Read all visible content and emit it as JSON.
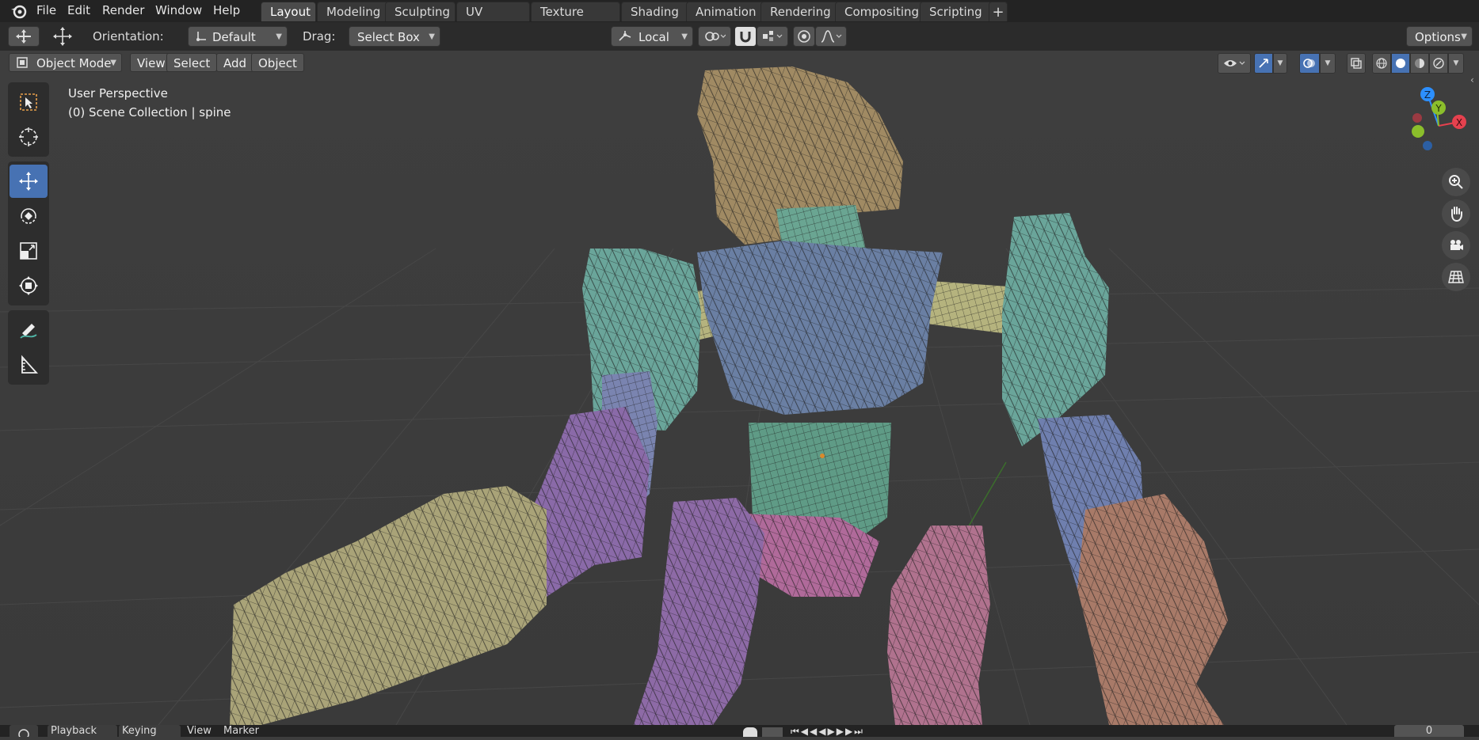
{
  "menu": [
    "File",
    "Edit",
    "Render",
    "Window",
    "Help"
  ],
  "workspace_tabs": [
    "Layout",
    "Modeling",
    "Sculpting",
    "UV Editing",
    "Texture Paint",
    "Shading",
    "Animation",
    "Rendering",
    "Compositing",
    "Scripting"
  ],
  "active_tab": "Layout",
  "add_workspace_icon": "plus-icon",
  "tool_header": {
    "orientation_label": "Orientation:",
    "orientation_value": "Default",
    "drag_label": "Drag:",
    "drag_value": "Select Box",
    "pivot_value": "Local",
    "options_label": "Options"
  },
  "viewport_header": {
    "mode": "Object Mode",
    "menus": [
      "View",
      "Select",
      "Add",
      "Object"
    ]
  },
  "viewport": {
    "view_name": "User Perspective",
    "collection_info": "(0) Scene Collection | spine"
  },
  "gizmo_axes": [
    "Z",
    "Y",
    "X"
  ],
  "toolbar_tools": [
    "select-box-icon",
    "cursor-icon",
    "move-icon",
    "rotate-icon",
    "scale-icon",
    "transform-icon",
    "annotate-icon",
    "measure-icon"
  ],
  "active_tool": "move-icon",
  "nav_icons": [
    "zoom-icon",
    "pan-hand-icon",
    "camera-icon",
    "grid-view-icon"
  ],
  "timeline": {
    "items": [
      "Playback",
      "Keying",
      "View",
      "Marker"
    ],
    "frame": "0"
  },
  "colors": {
    "accent": "#4772b3",
    "header": "#232323",
    "viewport_bg": "#3d3d3d",
    "axis_x": "#e5414e",
    "axis_y": "#8bbe2b",
    "axis_z": "#2c8fff"
  }
}
